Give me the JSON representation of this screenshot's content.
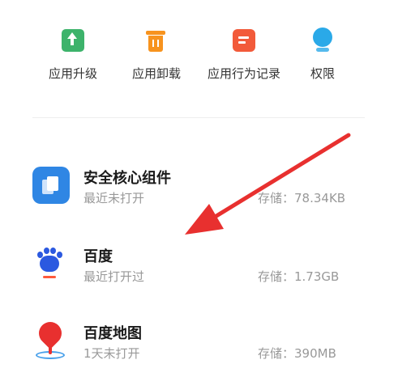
{
  "toolbar": {
    "items": [
      {
        "label": "应用升级",
        "icon": "upgrade-icon",
        "color": "#3db36b"
      },
      {
        "label": "应用卸载",
        "icon": "trash-icon",
        "color": "#f7931e"
      },
      {
        "label": "应用行为记录",
        "icon": "record-icon",
        "color": "#f25a3a"
      },
      {
        "label": "权限",
        "icon": "permission-icon",
        "color": "#2aa9e8"
      }
    ]
  },
  "apps": [
    {
      "name": "安全核心组件",
      "status": "最近未打开",
      "storage": "存储：78.34KB",
      "icon": "security-core-icon"
    },
    {
      "name": "百度",
      "status": "最近打开过",
      "storage": "存储：1.73GB",
      "icon": "baidu-icon"
    },
    {
      "name": "百度地图",
      "status": "1天未打开",
      "storage": "存储：390MB",
      "icon": "baidu-map-icon"
    }
  ],
  "annotation": {
    "color": "#e8302f"
  }
}
